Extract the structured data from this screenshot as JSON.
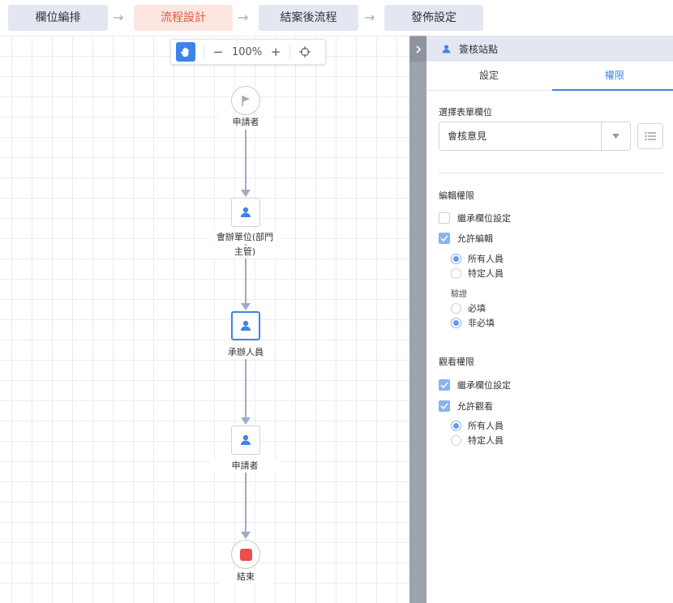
{
  "stepper": {
    "steps": [
      {
        "label": "欄位編排",
        "active": false
      },
      {
        "label": "流程設計",
        "active": true
      },
      {
        "label": "結案後流程",
        "active": false
      },
      {
        "label": "發佈設定",
        "active": false
      }
    ],
    "arrow": "→"
  },
  "canvas": {
    "zoom": {
      "minus": "−",
      "value": "100%",
      "plus": "+"
    },
    "nodes": [
      {
        "type": "start",
        "icon": "flag-icon",
        "label": "申請者"
      },
      {
        "type": "approver",
        "icon": "user-icon",
        "label_line1": "會辦單位(部門",
        "label_line2": "主管)"
      },
      {
        "type": "approver",
        "icon": "user-icon",
        "label": "承辦人員",
        "selected": true
      },
      {
        "type": "approver",
        "icon": "user-icon",
        "label": "申請者"
      },
      {
        "type": "end",
        "icon": "stop-icon",
        "label": "結束"
      }
    ]
  },
  "panel": {
    "header_title": "簽核站點",
    "tabs": [
      "設定",
      "權限"
    ],
    "active_tab": "權限",
    "select_field_title": "選擇表單欄位",
    "select_value": "會核意見",
    "edit_section": {
      "title": "編輯權限",
      "inherit": {
        "label": "繼承欄位設定",
        "checked": false
      },
      "allow": {
        "label": "允許編輯",
        "checked": true
      },
      "scope_options": [
        {
          "label": "所有人員",
          "checked": true
        },
        {
          "label": "特定人員",
          "checked": false
        }
      ],
      "validation_label": "驗證",
      "validation_options": [
        {
          "label": "必填",
          "checked": false
        },
        {
          "label": "非必填",
          "checked": true
        }
      ]
    },
    "view_section": {
      "title": "觀看權限",
      "inherit": {
        "label": "繼承欄位設定",
        "checked": true
      },
      "allow": {
        "label": "允許觀看",
        "checked": true
      },
      "scope_options": [
        {
          "label": "所有人員",
          "checked": true
        },
        {
          "label": "特定人員",
          "checked": false
        }
      ]
    }
  },
  "colors": {
    "accent": "#3d84e8",
    "active_step_bg": "#fde6e1",
    "active_step_text": "#e8573f",
    "step_bg": "#e3e7f2",
    "end_node": "#f04b4b",
    "edge": "#9eabc6"
  }
}
